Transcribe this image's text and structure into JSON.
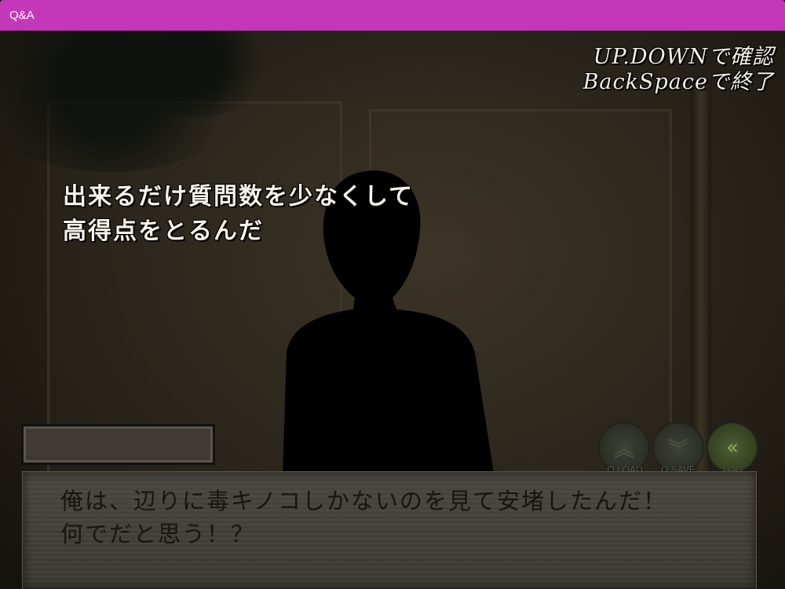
{
  "window": {
    "title": "Q&A"
  },
  "hint": {
    "line1": "UP.DOWNで確認",
    "line2": "BackSpaceで終了"
  },
  "question": {
    "line1": "出来るだけ質問数を少なくして",
    "line2": "高得点をとるんだ"
  },
  "namebox": {
    "name": ""
  },
  "controls": {
    "qload": {
      "label": "Q.LOAD",
      "icon": "double-chevron-up-icon"
    },
    "qsave": {
      "label": "Q.SAVE",
      "icon": "double-chevron-down-icon"
    },
    "log": {
      "label": "LOG",
      "icon": "double-chevron-left-icon"
    }
  },
  "dialogue": {
    "line1": "俺は、辺りに毒キノコしかないのを見て安堵したんだ！",
    "line2": "何でだと思う！？"
  },
  "colors": {
    "titlebar": "#c238b8",
    "text": "#f6f3ea",
    "dialogue_text": "#151512",
    "log_accent": "#8ea860"
  }
}
